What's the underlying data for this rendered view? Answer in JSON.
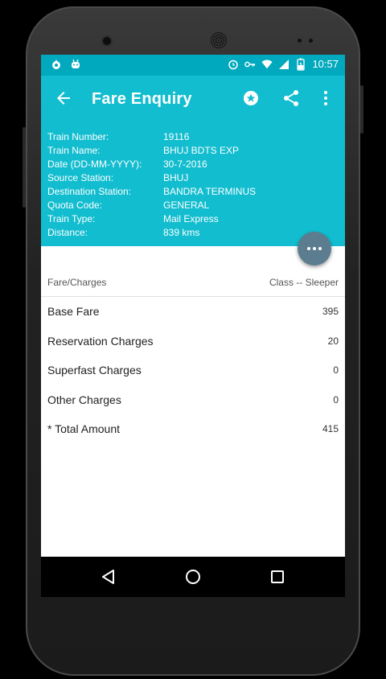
{
  "status_bar": {
    "time": "10:57",
    "left_icons": [
      "fire-ball-icon",
      "android-icon"
    ],
    "right_icons": [
      "alarm-icon",
      "key-icon",
      "wifi-icon",
      "signal-icon",
      "battery-charging-icon"
    ]
  },
  "app_bar": {
    "title": "Fare Enquiry",
    "back_icon": "arrow-back-icon",
    "actions": [
      "star-icon",
      "share-icon",
      "more-vert-icon"
    ]
  },
  "train_info": [
    {
      "label": "Train Number:",
      "value": "19116"
    },
    {
      "label": "Train Name:",
      "value": "BHUJ BDTS EXP"
    },
    {
      "label": "Date (DD-MM-YYYY):",
      "value": "30-7-2016"
    },
    {
      "label": "Source Station:",
      "value": "BHUJ"
    },
    {
      "label": "Destination Station:",
      "value": "BANDRA TERMINUS"
    },
    {
      "label": "Quota Code:",
      "value": "GENERAL"
    },
    {
      "label": "Train Type:",
      "value": "Mail Express"
    },
    {
      "label": "Distance:",
      "value": "839 kms"
    }
  ],
  "table": {
    "header_left": "Fare/Charges",
    "header_right": "Class -- Sleeper",
    "rows": [
      {
        "name": "Base Fare",
        "amount": "395"
      },
      {
        "name": "Reservation Charges",
        "amount": "20"
      },
      {
        "name": "Superfast Charges",
        "amount": "0"
      },
      {
        "name": "Other Charges",
        "amount": "0"
      },
      {
        "name": "* Total Amount",
        "amount": "415"
      }
    ]
  },
  "fab_icon": "more-horiz-icon",
  "nav_bar": [
    "back-triangle-icon",
    "home-circle-icon",
    "recents-square-icon"
  ],
  "colors": {
    "primary": "#12bdcf",
    "status": "#00a9bd",
    "fab": "#5b7d8f"
  }
}
